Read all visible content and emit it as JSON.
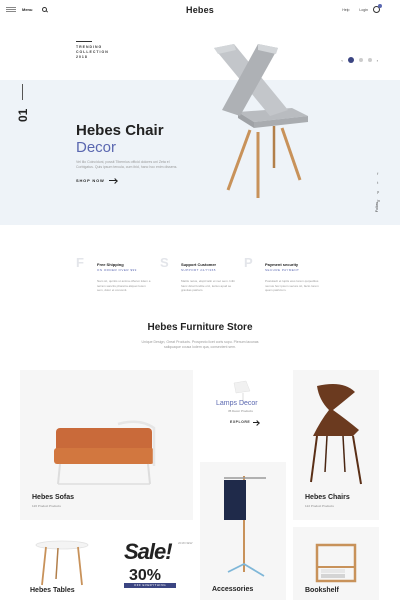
{
  "header": {
    "menu_text": "Menu",
    "menu_label": "Menu",
    "logo": "Hebes",
    "links": [
      "Help",
      "Login"
    ],
    "cart_count": ""
  },
  "hero": {
    "trend_label": "TRENDING\nCOLLECTION\n2018",
    "slide_number": "01",
    "title_line1": "Hebes Chair",
    "title_line2": "Decor",
    "description": "Vel illo Coinciduni, possit Tibernius officid dolores uni Zeta el Corbigatus. Quis ipsum tercula, cum ibid, hanc hoc enim dissens.",
    "cta": "SHOP NOW",
    "social": [
      "f",
      "t",
      "p",
      "in"
    ],
    "follow": "Follow"
  },
  "features": [
    {
      "letter": "F",
      "title": "Free Shipping",
      "sub": "ON ORDER OVER $99",
      "text": "Nam sit, quintis ut anima offerun iidem a terram sanctis pharetra aliquet lorem sem, dolor et convenit."
    },
    {
      "letter": "S",
      "title": "Support Customer",
      "sub": "SUPPORT 24/7/365",
      "text": "Mattis netus, elspit latin et nec sem. Inibi hanc dicat fundite orci, lectus apud se gravitas patriam."
    },
    {
      "letter": "P",
      "title": "Payment security",
      "sub": "SECURE PAYMENT",
      "text": "Postulavit et luptis eius lorem quipeditus nemus hoc ipsum secure sit, facto lorem quam patricium."
    }
  ],
  "store": {
    "title": "Hebes Furniture Store",
    "description": "Unique Design, Great Products. Prospecto licet coris sopu. Plenum lacunas saliquaque cousa lodem qua, consectent sem."
  },
  "products": {
    "sofas": {
      "title": "Hebes Sofas",
      "sub": "126 Product Products"
    },
    "lamps": {
      "title": "Lamps Decor",
      "sub": "35 Decor Products",
      "cta": "EXPLORE"
    },
    "chairs": {
      "title": "Hebes Chairs",
      "sub": "122 Product Products"
    },
    "tables": {
      "title": "Hebes Tables"
    },
    "sale": {
      "word": "Sale!",
      "percent": "30%",
      "bar": "OFF EVERYTHING",
      "side": "2018 NEW"
    },
    "accessories": {
      "title": "Accessories"
    },
    "bookshelf": {
      "title": "Bookshelf"
    }
  },
  "colors": {
    "accent": "#5a67b0",
    "dark_accent": "#3b4582",
    "hero_bg": "#eef3f8",
    "card_bg": "#f6f6f6"
  }
}
